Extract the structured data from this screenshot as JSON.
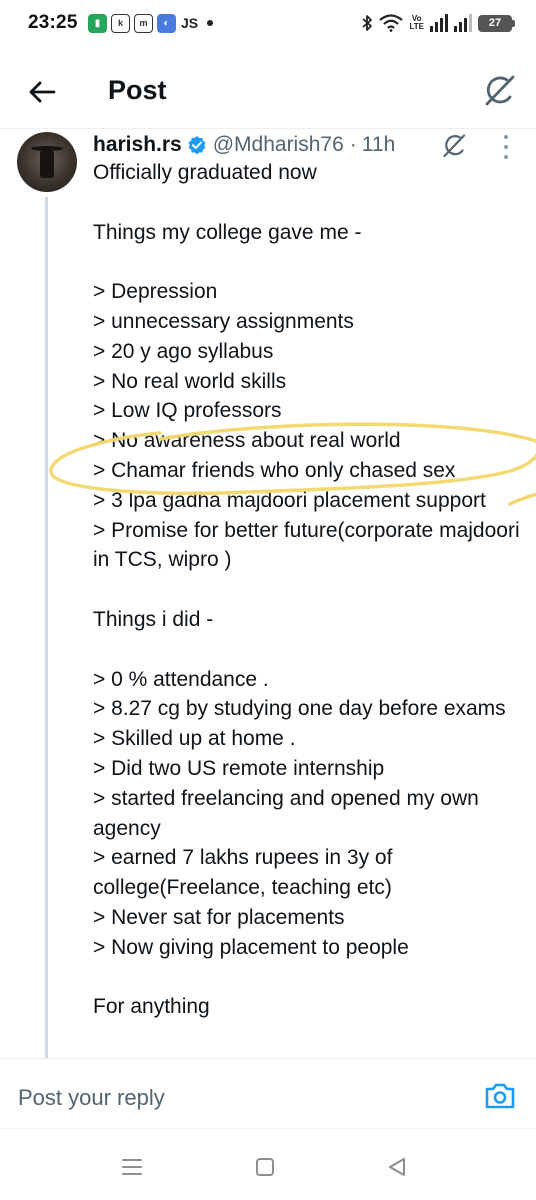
{
  "status_bar": {
    "time": "23:25",
    "notification_icons": [
      "app-green-icon",
      "app-outline-k-icon",
      "app-outline-m-icon",
      "app-blue-icon"
    ],
    "js_label": "JS",
    "volte_top": "Vo",
    "volte_bottom": "LTE",
    "battery_level": "27"
  },
  "header": {
    "title": "Post"
  },
  "post": {
    "author_name": "harish.rs",
    "handle": "@Mdharish76",
    "separator": "·",
    "time": "11h",
    "verified": true,
    "body": "Officially graduated now\n\nThings my college gave me -\n\n> Depression\n> unnecessary assignments\n> 20 y ago syllabus\n> No real world skills\n> Low IQ professors\n> No awareness about real world\n> Chamar friends who only chased sex\n> 3 lpa gadha majdoori placement support\n> Promise for better future(corporate majdoori in TCS, wipro )\n\nThings i did -\n\n> 0 % attendance .\n> 8.27 cg by studying one day before exams\n> Skilled up at home .\n> Did two US remote internship\n> started freelancing and opened my own agency\n> earned 7 lakhs rupees in 3y of college(Freelance, teaching etc)\n> Never sat for placements\n> Now giving placement to people\n\nFor anything"
  },
  "reply": {
    "placeholder": "Post your reply"
  },
  "colors": {
    "highlight": "#f5dc7a",
    "verified": "#1d9bf0",
    "accent": "#1d9bf0",
    "muted_text": "#536471"
  }
}
